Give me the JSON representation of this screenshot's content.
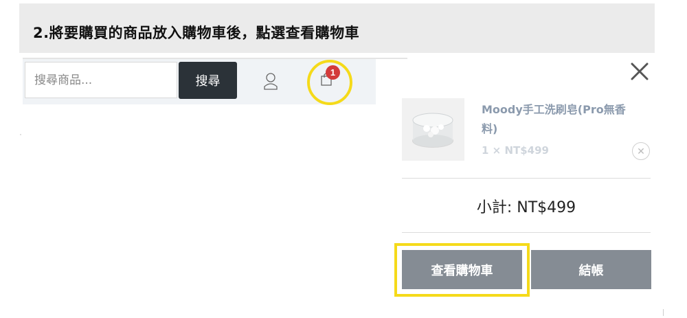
{
  "banner": {
    "instruction": "2.將要購買的商品放入購物車後，點選查看購物車"
  },
  "header": {
    "search_placeholder": "搜尋商品...",
    "search_button": "搜尋",
    "user_icon": "user-icon",
    "cart_icon": "shopping-bag-icon",
    "cart_count": "1",
    "highlight_color": "#f5da1a",
    "badge_color": "#d33b3b"
  },
  "mini_cart": {
    "close_icon": "close-icon",
    "items": [
      {
        "name": "Moody手工洗刷皂(Pro無香料)",
        "qty_price": "1 × NT$499",
        "remove_icon": "remove-icon"
      }
    ],
    "subtotal": "小計: NT$499",
    "view_cart_label": "查看購物車",
    "checkout_label": "結帳",
    "button_color": "#858c94"
  }
}
